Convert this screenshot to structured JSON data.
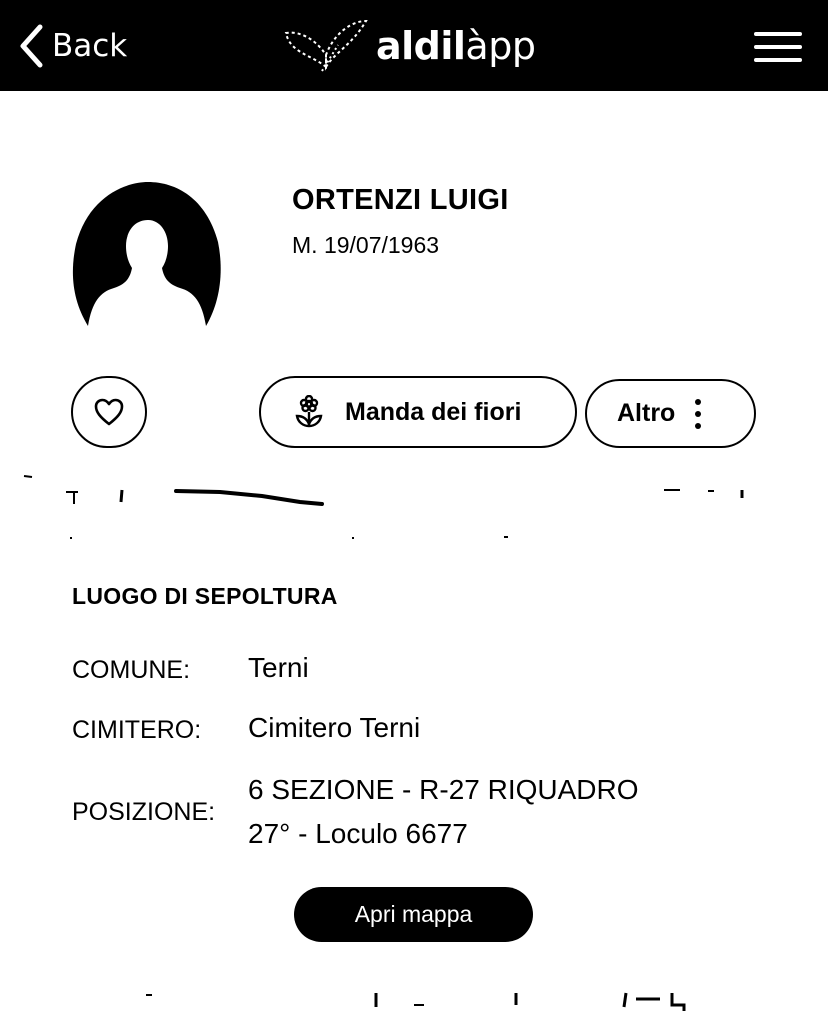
{
  "header": {
    "back_label": "Back",
    "logo_text_bold": "aldil",
    "logo_text_light": "àpp"
  },
  "profile": {
    "name": "ORTENZI LUIGI",
    "dates": "M. 19/07/1963"
  },
  "actions": {
    "flowers_label": "Manda dei fiori",
    "more_label": "Altro"
  },
  "burial": {
    "section_title": "LUOGO DI SEPOLTURA",
    "comune_label": "COMUNE:",
    "comune_value": "Terni",
    "cimitero_label": "CIMITERO:",
    "cimitero_value": "Cimitero Terni",
    "posizione_label": "POSIZIONE:",
    "posizione_line1": "6 SEZIONE - R-27 RIQUADRO",
    "posizione_line2": "27° - Loculo 6677",
    "map_button_label": "Apri mappa"
  },
  "colors": {
    "header_bg": "#000000",
    "page_bg": "#ffffff",
    "text": "#000000"
  }
}
